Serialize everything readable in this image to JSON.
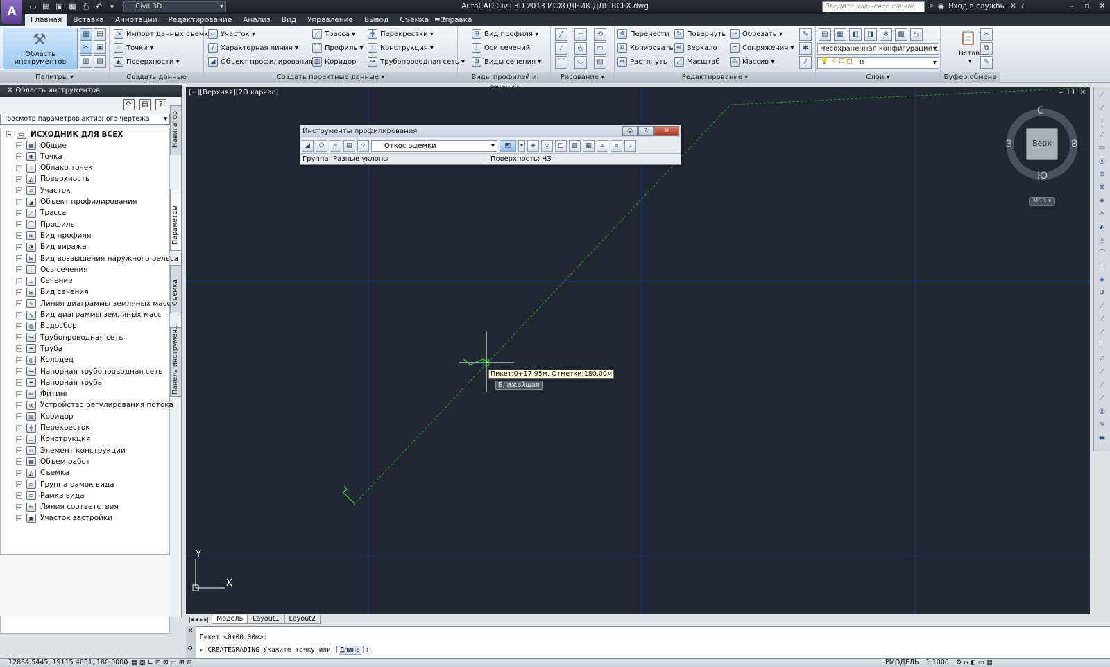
{
  "titlebar": {
    "app_letter": "A",
    "workspace": "Civil 3D",
    "title": "AutoCAD Civil 3D 2013    ИСХОДНИК ДЛЯ ВСЕХ.dwg",
    "search_placeholder": "Введите ключевое слово/фразу",
    "signin": "Вход в службы"
  },
  "tabs": [
    "Главная",
    "Вставка",
    "Аннотации",
    "Редактирование",
    "Анализ",
    "Вид",
    "Управление",
    "Вывод",
    "Съемка",
    "Справка"
  ],
  "ribbon": {
    "palettes": {
      "big_button": "Область инструментов",
      "title": "Палитры"
    },
    "ground_data": {
      "import": "Импорт данных съемки",
      "points": "Точки",
      "surfaces": "Поверхности",
      "title": "Создать данные рельефа"
    },
    "design": {
      "parcel": "Участок",
      "featureline": "Характерная линия",
      "grading": "Объект профилирования",
      "alignment": "Трасса",
      "profile": "Профиль",
      "corridor": "Коридор",
      "intersections": "Перекрестки",
      "assembly": "Конструкция",
      "pipe_network": "Трубопроводная сеть",
      "title": "Создать проектные данные"
    },
    "views": {
      "profile_view": "Вид профиля",
      "sample_lines": "Оси сечений",
      "section_views": "Виды сечения",
      "title": "Виды профилей и сечений"
    },
    "draw": {
      "title": "Рисование"
    },
    "modify": {
      "move": "Перенести",
      "rotate": "Повернуть",
      "trim": "Обрезать",
      "copy": "Копировать",
      "mirror": "Зеркало",
      "fillet": "Сопряжения",
      "stretch": "Растянуть",
      "scale": "Масштаб",
      "array": "Массив",
      "title": "Редактирование"
    },
    "layers": {
      "config": "Несохраненная конфигурация слоя",
      "layer": "0",
      "title": "Слои"
    },
    "clipboard": {
      "paste": "Вставить",
      "title": "Буфер обмена"
    }
  },
  "palette": {
    "header": "Область инструментов",
    "selector": "Просмотр параметров активного чертежа",
    "root": "ИСХОДНИК ДЛЯ ВСЕХ",
    "items": [
      "Общие",
      "Точка",
      "Облако точек",
      "Поверхность",
      "Участок",
      "Объект профилирования",
      "Трасса",
      "Профиль",
      "Вид профиля",
      "Вид виража",
      "Вид возвышения наружного рельса",
      "Ось сечения",
      "Сечение",
      "Вид сечения",
      "Линия диаграммы земляных масс",
      "Вид диаграммы земляных масс",
      "Водосбор",
      "Трубопроводная сеть",
      "Труба",
      "Колодец",
      "Напорная трубопроводная сеть",
      "Напорная труба",
      "Фитинг",
      "Устройство регулирования потока",
      "Коридор",
      "Перекресток",
      "Конструкция",
      "Элемент конструкции",
      "Объем работ",
      "Съемка",
      "Группа рамок вида",
      "Рамка вида",
      "Линия соответствия",
      "Участок застройки"
    ],
    "side_tabs": [
      "Навигатор",
      "Параметры",
      "Съемка",
      "Панель инструмен..."
    ]
  },
  "viewport": {
    "label": "[−][Верхняя][2D каркас]",
    "viewcube": {
      "north": "С",
      "south": "Ю",
      "west": "З",
      "east": "В",
      "face": "Верх",
      "ucs": "МСК"
    },
    "tooltip": "Пикет:0+17.95м, Отметки:180.00м",
    "snap": "Ближайшая",
    "axis_y": "Y",
    "axis_x": "X"
  },
  "grading_toolbar": {
    "title": "Инструменты профилирования",
    "criteria": "Откос выемки",
    "group": "Группа: Разные уклоны",
    "surface": "Поверхность: ЧЗ"
  },
  "layout_tabs": [
    "Модель",
    "Layout1",
    "Layout2"
  ],
  "command": {
    "line1": "Пикет <0+00.00м>:",
    "prefix": "CREATEGRADING Укажите точку или [",
    "option": "Длина",
    "suffix": "]:"
  },
  "status": {
    "coords": "12834.5445, 19115.4651, 180.0000",
    "space": "РМОДЕЛЬ",
    "scale": "1:1000"
  },
  "colors": {
    "canvas_bg": "#222832",
    "grid_line": "#1a2fb0",
    "grading_line": "#2aa02a"
  }
}
